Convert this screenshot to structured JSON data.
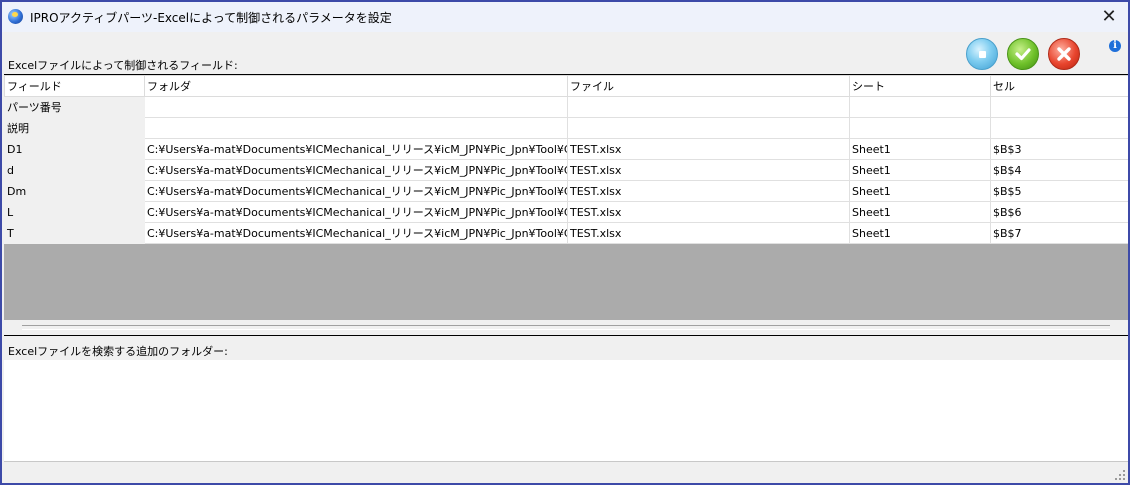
{
  "window": {
    "title": "IPROアクティブパーツ-Excelによって制御されるパラメータを設定",
    "close_glyph": "✕"
  },
  "toolbar": {
    "info_glyph": "i",
    "buttons": [
      "blue-square-button",
      "ok-check-icon",
      "cancel-x-icon"
    ]
  },
  "fields_section": {
    "label": "Excelファイルによって制御されるフィールド:"
  },
  "grid": {
    "columns": [
      "フィールド",
      "フォルダ",
      "ファイル",
      "シート",
      "セル"
    ],
    "rows": [
      {
        "field": "パーツ番号",
        "folder": "",
        "file": "",
        "sheet": "",
        "cell": ""
      },
      {
        "field": "説明",
        "folder": "",
        "file": "",
        "sheet": "",
        "cell": ""
      },
      {
        "field": "D1",
        "folder": "C:¥Users¥a-mat¥Documents¥ICMechanical_リリース¥icM_JPN¥Pic_Jpn¥Tool¥Crea...",
        "file": "TEST.xlsx",
        "sheet": "Sheet1",
        "cell": "$B$3"
      },
      {
        "field": "d",
        "folder": "C:¥Users¥a-mat¥Documents¥ICMechanical_リリース¥icM_JPN¥Pic_Jpn¥Tool¥Crea...",
        "file": "TEST.xlsx",
        "sheet": "Sheet1",
        "cell": "$B$4"
      },
      {
        "field": "Dm",
        "folder": "C:¥Users¥a-mat¥Documents¥ICMechanical_リリース¥icM_JPN¥Pic_Jpn¥Tool¥Crea...",
        "file": "TEST.xlsx",
        "sheet": "Sheet1",
        "cell": "$B$5"
      },
      {
        "field": "L",
        "folder": "C:¥Users¥a-mat¥Documents¥ICMechanical_リリース¥icM_JPN¥Pic_Jpn¥Tool¥Crea...",
        "file": "TEST.xlsx",
        "sheet": "Sheet1",
        "cell": "$B$6"
      },
      {
        "field": "T",
        "folder": "C:¥Users¥a-mat¥Documents¥ICMechanical_リリース¥icM_JPN¥Pic_Jpn¥Tool¥Crea...",
        "file": "TEST.xlsx",
        "sheet": "Sheet1",
        "cell": "$B$7"
      }
    ]
  },
  "folders_section": {
    "label": "Excelファイルを検索する追加のフォルダー:"
  },
  "colors": {
    "window_border": "#3d4aa8",
    "grid_empty_area": "#ababab",
    "ok_green": "#6fc12a",
    "cancel_red": "#e8452e",
    "accent_blue": "#7fcdf0"
  }
}
